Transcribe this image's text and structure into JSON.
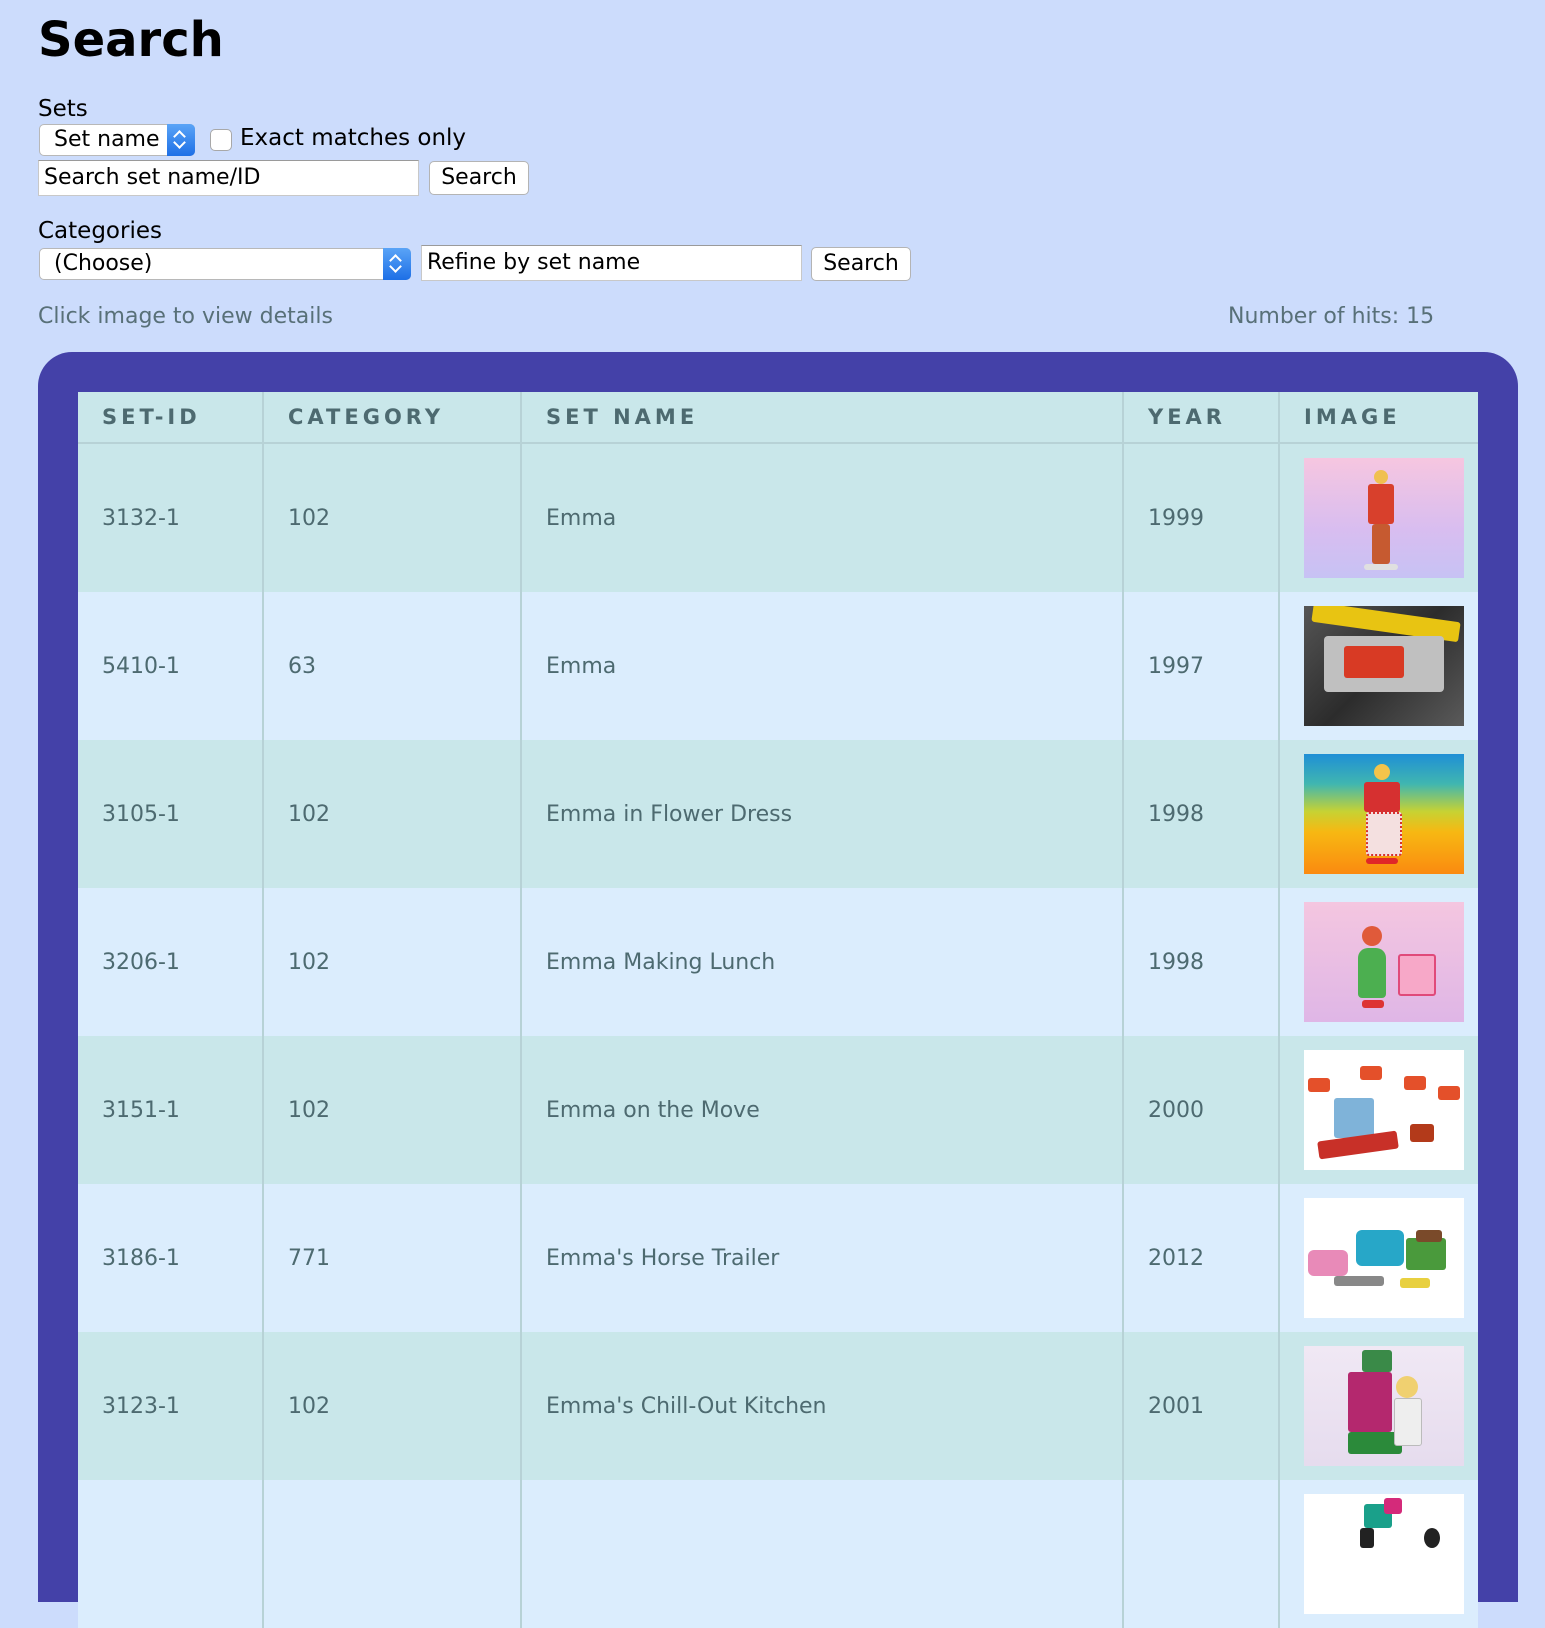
{
  "page": {
    "title": "Search"
  },
  "sets": {
    "label": "Sets",
    "select_value": "Set name",
    "exact_label": "Exact matches only",
    "search_placeholder": "Search set name/ID",
    "search_button": "Search"
  },
  "categories": {
    "label": "Categories",
    "select_value": "(Choose)",
    "refine_placeholder": "Refine by set name",
    "search_button": "Search"
  },
  "results": {
    "hint": "Click image to view details",
    "hits": "Number of hits: 15",
    "columns": [
      "SET-ID",
      "CATEGORY",
      "SET NAME",
      "YEAR",
      "IMAGE"
    ],
    "rows": [
      {
        "set_id": "3132-1",
        "category": "102",
        "set_name": "Emma",
        "year": "1999"
      },
      {
        "set_id": "5410-1",
        "category": "63",
        "set_name": "Emma",
        "year": "1997"
      },
      {
        "set_id": "3105-1",
        "category": "102",
        "set_name": "Emma in Flower Dress",
        "year": "1998"
      },
      {
        "set_id": "3206-1",
        "category": "102",
        "set_name": "Emma Making Lunch",
        "year": "1998"
      },
      {
        "set_id": "3151-1",
        "category": "102",
        "set_name": "Emma on the Move",
        "year": "2000"
      },
      {
        "set_id": "3186-1",
        "category": "771",
        "set_name": "Emma's Horse Trailer",
        "year": "2012"
      },
      {
        "set_id": "3123-1",
        "category": "102",
        "set_name": "Emma's Chill-Out Kitchen",
        "year": "2001"
      },
      {
        "set_id": "",
        "category": "",
        "set_name": "",
        "year": ""
      }
    ]
  }
}
